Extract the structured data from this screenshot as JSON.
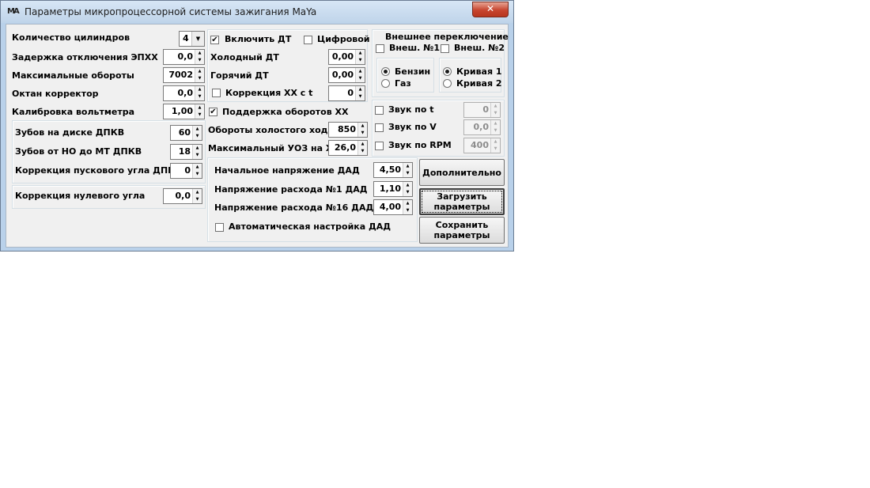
{
  "window": {
    "title": "Параметры микропроцессорной системы зажигания MaYa",
    "icon": "MA",
    "close": "✕"
  },
  "left": {
    "cylinders_label": "Количество цилиндров",
    "cylinders_value": "4",
    "epxx_delay_label": "Задержка отключения ЭПХХ",
    "epxx_delay_value": "0,0",
    "max_rpm_label": "Максимальные обороты",
    "max_rpm_value": "7002",
    "octane_label": "Октан корректор",
    "octane_value": "0,0",
    "voltmeter_label": "Калибровка вольтметра",
    "voltmeter_value": "1,00",
    "teeth_label": "Зубов на диске ДПКВ",
    "teeth_value": "60",
    "teeth_tdc_label": "Зубов от НО до  МТ ДПКВ",
    "teeth_tdc_value": "18",
    "start_angle_label": "Коррекция пускового угла ДПКВ",
    "start_angle_value": "0",
    "zero_angle_label": "Коррекция нулевого угла",
    "zero_angle_value": "0,0"
  },
  "middle": {
    "enable_dt_label": "Включить ДТ",
    "enable_dt_checked": true,
    "digital_label": "Цифровой",
    "digital_checked": false,
    "cold_dt_label": "Холодный ДТ",
    "cold_dt_value": "0,00",
    "hot_dt_label": "Горячий ДТ",
    "hot_dt_value": "0,00",
    "idle_corr_label": "Коррекция ХХ с t",
    "idle_corr_value": "0",
    "idle_corr_checked": false,
    "idle_support_label": "Поддержка оборотов ХХ",
    "idle_support_checked": true,
    "idle_rpm_label": "Обороты холостого хода",
    "idle_rpm_value": "850",
    "max_uoz_label": "Максимальный УОЗ на ХХ",
    "max_uoz_value": "26,0"
  },
  "dad": {
    "start_voltage_label": "Начальное напряжение ДАД",
    "start_voltage_value": "4,50",
    "flow1_label": "Напряжение расхода №1 ДАД",
    "flow1_value": "1,10",
    "flow16_label": "Напряжение расхода №16 ДАД",
    "flow16_value": "4,00",
    "auto_label": "Автоматическая настройка ДАД",
    "auto_checked": false
  },
  "external": {
    "title": "Внешнее переключение",
    "ext1_label": "Внеш. №1",
    "ext2_label": "Внеш. №2",
    "fuel_petrol": "Бензин",
    "fuel_gas": "Газ",
    "curve1": "Кривая 1",
    "curve2": "Кривая 2"
  },
  "sound": {
    "by_t_label": "Звук по t",
    "by_t_value": "0",
    "by_v_label": "Звук по V",
    "by_v_value": "0,0",
    "by_rpm_label": "Звук по RPM",
    "by_rpm_value": "400"
  },
  "buttons": {
    "additional": "Дополнительно",
    "load_line1": "Загрузить",
    "load_line2": "параметры",
    "save_line1": "Сохранить",
    "save_line2": "параметры"
  },
  "glyphs": {
    "check": "✔",
    "up": "▲",
    "down": "▼"
  }
}
